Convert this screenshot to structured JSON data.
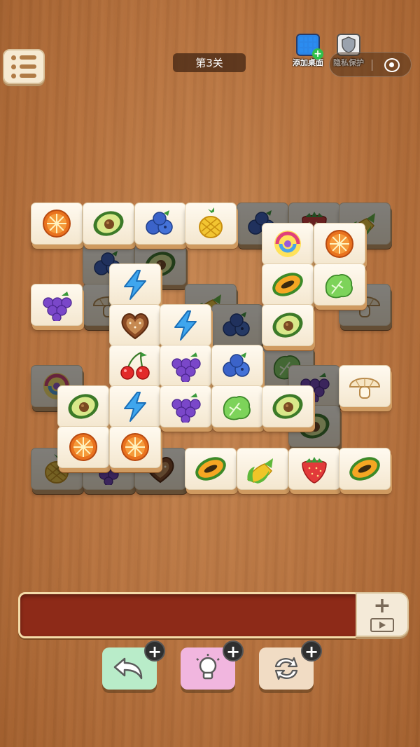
{
  "header": {
    "level_label": "第3关",
    "add_desktop_label": "添加桌面",
    "privacy_label": "隐私保护"
  },
  "colors": {
    "tray": "#8d2a18",
    "undo_button": "#b9ecc9",
    "hint_button": "#f1b6df",
    "shuffle_button": "#f1dcc4"
  },
  "board": {
    "tiles": [
      {
        "icon": "orange-slice",
        "layer": "top"
      },
      {
        "icon": "avocado",
        "layer": "top"
      },
      {
        "icon": "blueberry",
        "layer": "top"
      },
      {
        "icon": "pineapple",
        "layer": "top"
      },
      {
        "icon": "blueberry",
        "layer": "covered"
      },
      {
        "icon": "strawberry",
        "layer": "covered"
      },
      {
        "icon": "corn",
        "layer": "covered"
      },
      {
        "icon": "candy-swirl",
        "layer": "top"
      },
      {
        "icon": "orange-slice",
        "layer": "top"
      },
      {
        "icon": "blueberry",
        "layer": "covered"
      },
      {
        "icon": "avocado",
        "layer": "covered"
      },
      {
        "icon": "lightning",
        "layer": "top"
      },
      {
        "icon": "papaya",
        "layer": "top"
      },
      {
        "icon": "lettuce",
        "layer": "top"
      },
      {
        "icon": "grapes",
        "layer": "top"
      },
      {
        "icon": "mushroom",
        "layer": "covered"
      },
      {
        "icon": "corn",
        "layer": "covered"
      },
      {
        "icon": "mushroom",
        "layer": "covered"
      },
      {
        "icon": "heart-cookie",
        "layer": "top"
      },
      {
        "icon": "lightning",
        "layer": "top"
      },
      {
        "icon": "blueberry",
        "layer": "covered"
      },
      {
        "icon": "avocado",
        "layer": "top"
      },
      {
        "icon": "cherry",
        "layer": "top"
      },
      {
        "icon": "grapes",
        "layer": "top"
      },
      {
        "icon": "blueberry",
        "layer": "top"
      },
      {
        "icon": "lettuce",
        "layer": "covered"
      },
      {
        "icon": "candy-swirl",
        "layer": "covered"
      },
      {
        "icon": "grapes",
        "layer": "covered"
      },
      {
        "icon": "mushroom",
        "layer": "top"
      },
      {
        "icon": "avocado",
        "layer": "top"
      },
      {
        "icon": "lightning",
        "layer": "top"
      },
      {
        "icon": "grapes",
        "layer": "top"
      },
      {
        "icon": "lettuce",
        "layer": "top"
      },
      {
        "icon": "avocado",
        "layer": "top"
      },
      {
        "icon": "avocado",
        "layer": "covered"
      },
      {
        "icon": "orange-slice",
        "layer": "top"
      },
      {
        "icon": "orange-slice",
        "layer": "top"
      },
      {
        "icon": "pineapple",
        "layer": "covered"
      },
      {
        "icon": "grapes",
        "layer": "covered"
      },
      {
        "icon": "heart-cookie",
        "layer": "covered"
      },
      {
        "icon": "papaya",
        "layer": "top"
      },
      {
        "icon": "corn",
        "layer": "top"
      },
      {
        "icon": "strawberry",
        "layer": "top"
      },
      {
        "icon": "papaya",
        "layer": "top"
      }
    ]
  },
  "tray": {
    "slots_filled": 0
  },
  "tools": [
    {
      "name": "undo",
      "icon": "undo-arrow-icon"
    },
    {
      "name": "hint",
      "icon": "lightbulb-icon"
    },
    {
      "name": "shuffle",
      "icon": "shuffle-icon"
    }
  ]
}
